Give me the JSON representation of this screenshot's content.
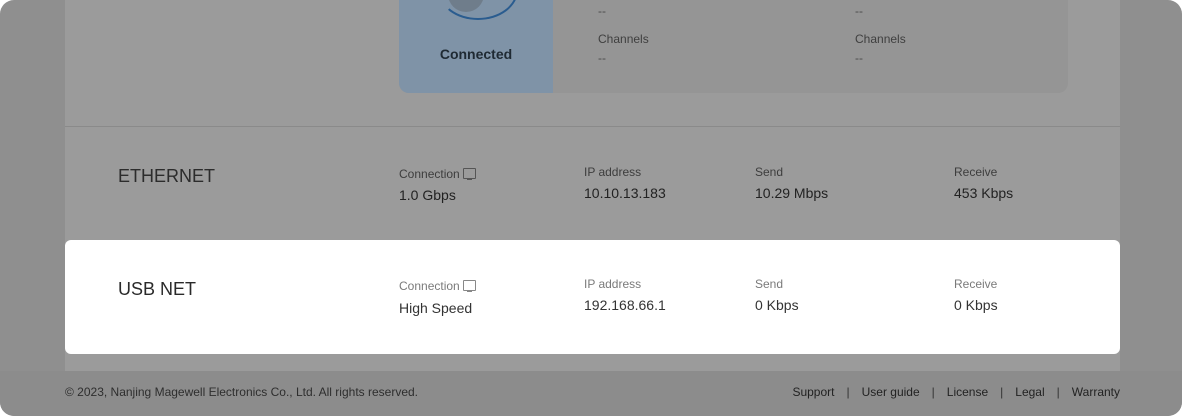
{
  "wifi": {
    "status_label": "Connected",
    "left_top_value": "--",
    "right_top_value": "--",
    "channels_label_left": "Channels",
    "channels_value_left": "--",
    "channels_label_right": "Channels",
    "channels_value_right": "--"
  },
  "ethernet": {
    "title": "ETHERNET",
    "connection_label": "Connection",
    "connection_value": "1.0 Gbps",
    "ip_label": "IP address",
    "ip_value": "10.10.13.183",
    "send_label": "Send",
    "send_value": "10.29 Mbps",
    "receive_label": "Receive",
    "receive_value": "453 Kbps"
  },
  "usbnet": {
    "title": "USB NET",
    "connection_label": "Connection",
    "connection_value": "High Speed",
    "ip_label": "IP address",
    "ip_value": "192.168.66.1",
    "send_label": "Send",
    "send_value": "0 Kbps",
    "receive_label": "Receive",
    "receive_value": "0 Kbps"
  },
  "footer": {
    "copyright": "© 2023, Nanjing Magewell Electronics Co., Ltd. All rights reserved.",
    "links": [
      "Support",
      "User guide",
      "License",
      "Legal",
      "Warranty"
    ],
    "separator": "|"
  },
  "icons": {
    "connection": "network-monitor-icon",
    "wifi_status": "globe-icon"
  }
}
